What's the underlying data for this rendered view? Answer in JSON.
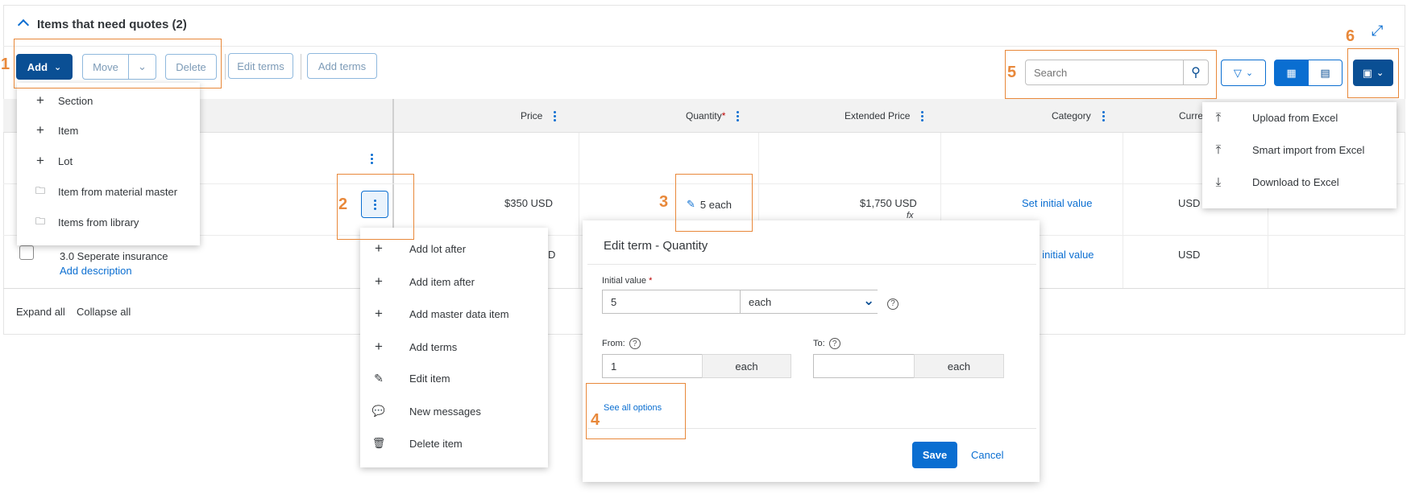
{
  "section_title": "Items that need quotes (2)",
  "toolbar": {
    "add_label": "Add",
    "move_label": "Move",
    "delete_label": "Delete",
    "edit_terms_label": "Edit terms",
    "add_terms_label": "Add terms",
    "search_placeholder": "Search"
  },
  "callouts": [
    "1",
    "2",
    "3",
    "4",
    "5",
    "6"
  ],
  "columns": {
    "price": "Price",
    "quantity": "Quantity",
    "required_mark": "*",
    "extended_price": "Extended Price",
    "category": "Category",
    "currency": "Curre"
  },
  "rows": [
    {
      "price": "$350 USD",
      "quantity": "5 each",
      "extended_price": "$1,750 USD",
      "fx": "fx",
      "category": "Set initial value",
      "currency": "USD"
    },
    {
      "name": "3.0 Seperate insurance",
      "add_description": "Add description",
      "price": "D",
      "category": "t initial value",
      "currency": "USD"
    }
  ],
  "footer": {
    "expand_all": "Expand all",
    "collapse_all": "Collapse all"
  },
  "add_menu": [
    "Section",
    "Item",
    "Lot",
    "Item from material master",
    "Items from library"
  ],
  "row_menu": [
    "Add lot after",
    "Add item after",
    "Add master data item",
    "Add terms",
    "Edit item",
    "New messages",
    "Delete item"
  ],
  "excel_menu": [
    "Upload from Excel",
    "Smart import from Excel",
    "Download to Excel"
  ],
  "dialog": {
    "title": "Edit term - Quantity",
    "initial_label": "Initial value",
    "required_mark": "*",
    "initial_value": "5",
    "unit": "each",
    "from_label": "From:",
    "from_value": "1",
    "from_unit": "each",
    "to_label": "To:",
    "to_value": "",
    "to_unit": "each",
    "see_all": "See all options",
    "save": "Save",
    "cancel": "Cancel"
  },
  "colors": {
    "accent": "#0a6ed1",
    "primary": "#0a4f94",
    "callout": "#e8883a"
  }
}
